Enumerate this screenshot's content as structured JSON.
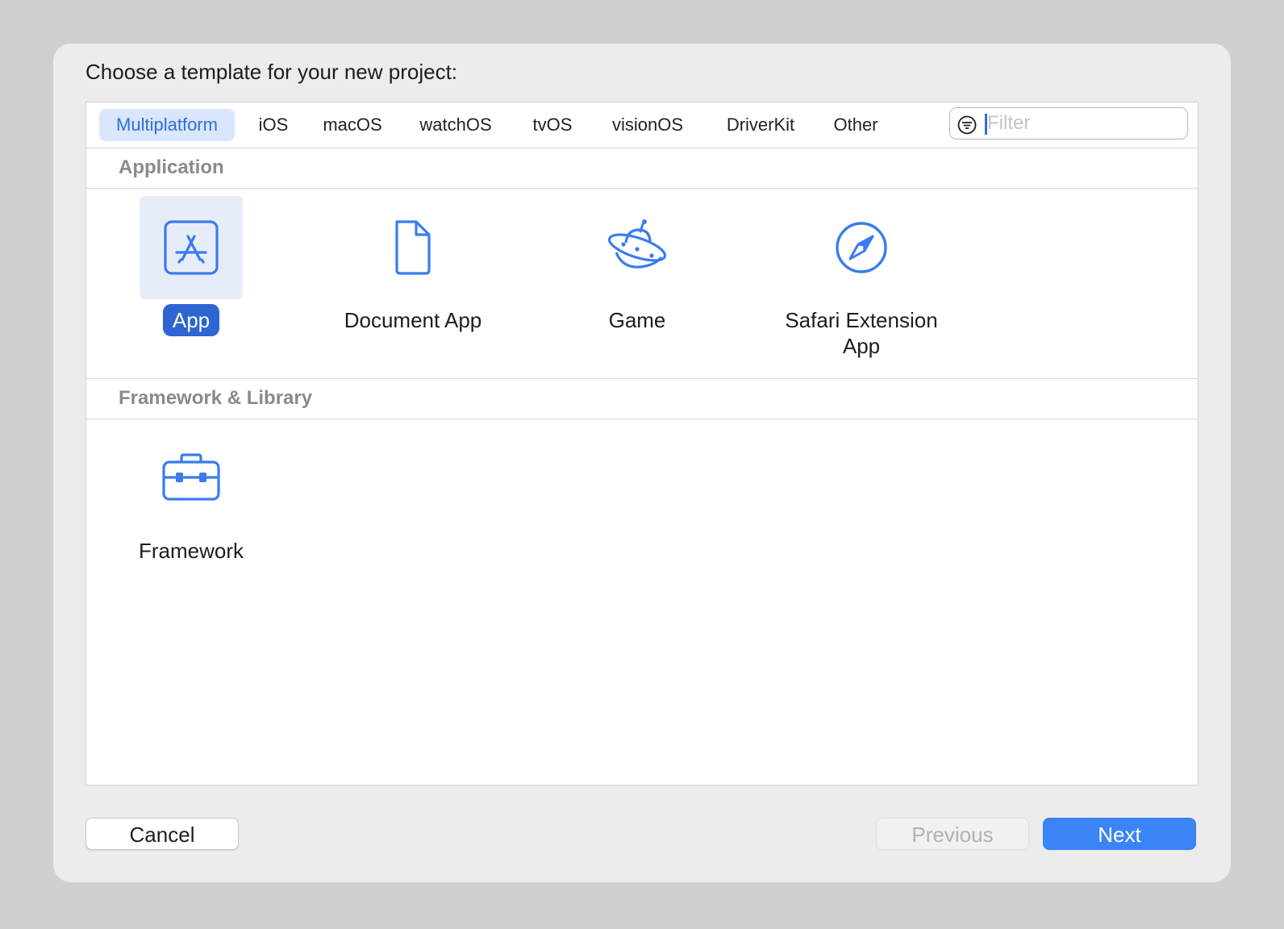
{
  "prompt": "Choose a template for your new project:",
  "tabs": [
    {
      "label": "Multiplatform",
      "selected": true
    },
    {
      "label": "iOS",
      "selected": false
    },
    {
      "label": "macOS",
      "selected": false
    },
    {
      "label": "watchOS",
      "selected": false
    },
    {
      "label": "tvOS",
      "selected": false
    },
    {
      "label": "visionOS",
      "selected": false
    },
    {
      "label": "DriverKit",
      "selected": false
    },
    {
      "label": "Other",
      "selected": false
    }
  ],
  "filter": {
    "placeholder": "Filter",
    "value": "",
    "icon": "filter-icon"
  },
  "sections": [
    {
      "title": "Application",
      "items": [
        {
          "label": "App",
          "icon": "app-store-icon",
          "selected": true
        },
        {
          "label": "Document App",
          "icon": "document-icon",
          "selected": false
        },
        {
          "label": "Game",
          "icon": "ufo-icon",
          "selected": false
        },
        {
          "label": "Safari Extension App",
          "icon": "compass-icon",
          "selected": false
        }
      ]
    },
    {
      "title": "Framework & Library",
      "items": [
        {
          "label": "Framework",
          "icon": "toolbox-icon",
          "selected": false
        }
      ]
    }
  ],
  "buttons": {
    "cancel": "Cancel",
    "previous": "Previous",
    "next": "Next"
  },
  "colors": {
    "accent": "#3a84f5",
    "selection": "#2e66d1",
    "icon": "#3a7bf0"
  }
}
